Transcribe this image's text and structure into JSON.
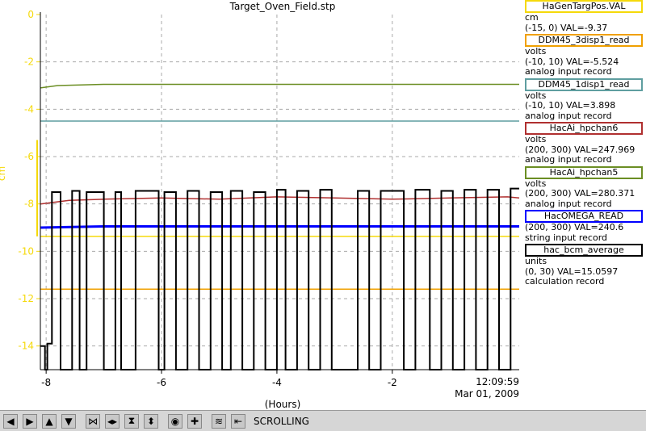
{
  "toolbar": {
    "buttons": [
      {
        "name": "pan-left-icon",
        "glyph": "◀"
      },
      {
        "name": "pan-right-icon",
        "glyph": "▶"
      },
      {
        "name": "pan-up-icon",
        "glyph": "▲"
      },
      {
        "name": "pan-down-icon",
        "glyph": "▼"
      },
      {
        "name": "zoom-in-horizontal-icon",
        "glyph": "⋈"
      },
      {
        "name": "zoom-out-horizontal-icon",
        "glyph": "◂▸"
      },
      {
        "name": "zoom-in-vertical-icon",
        "glyph": "⧗"
      },
      {
        "name": "zoom-out-vertical-icon",
        "glyph": "⬍"
      },
      {
        "name": "auto-scale-icon",
        "glyph": "◉"
      },
      {
        "name": "add-pv-icon",
        "glyph": "✚"
      },
      {
        "name": "config-icon",
        "glyph": "≋"
      },
      {
        "name": "mode-icon",
        "glyph": "⇤"
      }
    ],
    "status": "SCROLLING"
  },
  "legend": [
    {
      "name": "HaGenTargPos.VAL",
      "color": "#f5d90a",
      "lines": [
        "cm",
        "(-15, 0) VAL=-9.37"
      ]
    },
    {
      "name": "DDM45_3disp1_read",
      "color": "#f0a000",
      "lines": [
        "volts",
        "(-10, 10) VAL=-5.524",
        "analog input record"
      ]
    },
    {
      "name": "DDM45_1disp1_read",
      "color": "#5f9ea0",
      "lines": [
        "volts",
        "(-10, 10) VAL=3.898",
        "analog input record"
      ]
    },
    {
      "name": "HacAi_hpchan6",
      "color": "#b03030",
      "lines": [
        "volts",
        "(200, 300) VAL=247.969",
        "analog input record"
      ]
    },
    {
      "name": "HacAi_hpchan5",
      "color": "#6b8e23",
      "lines": [
        "volts",
        "(200, 300) VAL=280.371",
        "analog input record"
      ]
    },
    {
      "name": "HacOMEGA_READ",
      "color": "#0000ff",
      "lines": [
        "(200, 300) VAL=240.6",
        "string input record"
      ]
    },
    {
      "name": "hac_bcm_average",
      "color": "#000000",
      "lines": [
        "units",
        "(0, 30) VAL=15.0597",
        "calculation record"
      ]
    }
  ],
  "chart_data": {
    "type": "line",
    "title": "Target_Oven_Field.stp",
    "xlabel": "(Hours)",
    "ylabel": "cm",
    "xlim": [
      -8.1,
      0.2
    ],
    "ylim": [
      -15,
      0
    ],
    "x_ticks": [
      -8,
      -6,
      -4,
      -2
    ],
    "y_ticks": [
      0,
      -2,
      -4,
      -6,
      -8,
      -10,
      -12,
      -14
    ],
    "time_label": "12:09:59",
    "date_label": "Mar 01, 2009",
    "grid": true,
    "colors": {
      "axis": "#f5d90a",
      "grid": "#aaaaaa"
    },
    "series": [
      {
        "name": "HaGenTargPos.VAL",
        "color": "#f5d90a",
        "x": [
          -8.1,
          0.2
        ],
        "y": [
          -9.37,
          -9.37
        ]
      },
      {
        "name": "DDM45_3disp1_read",
        "color": "#f0a000",
        "x": [
          -8.1,
          0.2
        ],
        "y": [
          -11.6,
          -11.6
        ]
      },
      {
        "name": "DDM45_1disp1_read",
        "color": "#5f9ea0",
        "x": [
          -8.1,
          0.2
        ],
        "y": [
          -4.5,
          -4.5
        ]
      },
      {
        "name": "HacAi_hpchan6",
        "color": "#b03030",
        "x": [
          -8.1,
          -7.6,
          -7,
          -6,
          -5,
          -4,
          -3,
          -2,
          -1,
          0,
          0.2
        ],
        "y": [
          -8.0,
          -7.85,
          -7.8,
          -7.75,
          -7.8,
          -7.7,
          -7.75,
          -7.8,
          -7.75,
          -7.7,
          -7.75
        ]
      },
      {
        "name": "HacAi_hpchan5",
        "color": "#6b8e23",
        "x": [
          -8.1,
          -7.8,
          -7,
          -6,
          -5,
          -4,
          -3,
          -2,
          -1,
          0,
          0.2
        ],
        "y": [
          -3.1,
          -3.0,
          -2.95,
          -2.95,
          -2.95,
          -2.95,
          -2.95,
          -2.95,
          -2.95,
          -2.95,
          -2.95
        ]
      },
      {
        "name": "HacOMEGA_READ",
        "color": "#0000ff",
        "x": [
          -8.1,
          -7,
          -6,
          -5,
          -4,
          -3,
          -2,
          -1,
          0,
          0.2
        ],
        "y": [
          -9.0,
          -8.95,
          -8.95,
          -8.95,
          -8.95,
          -8.95,
          -8.95,
          -8.95,
          -8.95,
          -8.95
        ]
      },
      {
        "name": "hac_bcm_average",
        "color": "#000000",
        "x": [
          -8.1,
          -8.02,
          -8.02,
          -7.98,
          -7.98,
          -7.9,
          -7.9,
          -7.75,
          -7.75,
          -7.55,
          -7.55,
          -7.42,
          -7.42,
          -7.3,
          -7.3,
          -7.0,
          -7.0,
          -6.8,
          -6.8,
          -6.7,
          -6.7,
          -6.45,
          -6.45,
          -6.05,
          -6.05,
          -5.95,
          -5.95,
          -5.75,
          -5.75,
          -5.55,
          -5.55,
          -5.35,
          -5.35,
          -5.15,
          -5.15,
          -4.95,
          -4.95,
          -4.8,
          -4.8,
          -4.6,
          -4.6,
          -4.4,
          -4.4,
          -4.2,
          -4.2,
          -4.0,
          -4.0,
          -3.85,
          -3.85,
          -3.65,
          -3.65,
          -3.45,
          -3.45,
          -3.25,
          -3.25,
          -3.05,
          -3.05,
          -2.6,
          -2.6,
          -2.4,
          -2.4,
          -2.2,
          -2.2,
          -1.8,
          -1.8,
          -1.6,
          -1.6,
          -1.35,
          -1.35,
          -1.15,
          -1.15,
          -0.95,
          -0.95,
          -0.75,
          -0.75,
          -0.55,
          -0.55,
          -0.35,
          -0.35,
          -0.15,
          -0.15,
          0.05,
          0.05,
          0.2
        ],
        "y": [
          -14.0,
          -14.0,
          -15.0,
          -15.0,
          -13.9,
          -13.9,
          -7.5,
          -7.5,
          -15.0,
          -15.0,
          -7.45,
          -7.45,
          -15.0,
          -15.0,
          -7.5,
          -7.5,
          -15.0,
          -15.0,
          -7.5,
          -7.5,
          -15.0,
          -15.0,
          -7.45,
          -7.45,
          -15.0,
          -15.0,
          -7.5,
          -7.5,
          -15.0,
          -15.0,
          -7.45,
          -7.45,
          -15.0,
          -15.0,
          -7.5,
          -7.5,
          -15.0,
          -15.0,
          -7.45,
          -7.45,
          -15.0,
          -15.0,
          -7.5,
          -7.5,
          -15.0,
          -15.0,
          -7.4,
          -7.4,
          -15.0,
          -15.0,
          -7.45,
          -7.45,
          -15.0,
          -15.0,
          -7.4,
          -7.4,
          -15.0,
          -15.0,
          -7.45,
          -7.45,
          -15.0,
          -15.0,
          -7.45,
          -7.45,
          -15.0,
          -15.0,
          -7.4,
          -7.4,
          -15.0,
          -15.0,
          -7.45,
          -7.45,
          -15.0,
          -15.0,
          -7.4,
          -7.4,
          -15.0,
          -15.0,
          -7.4,
          -7.4,
          -15.0,
          -15.0,
          -7.35,
          -7.35
        ]
      }
    ]
  }
}
